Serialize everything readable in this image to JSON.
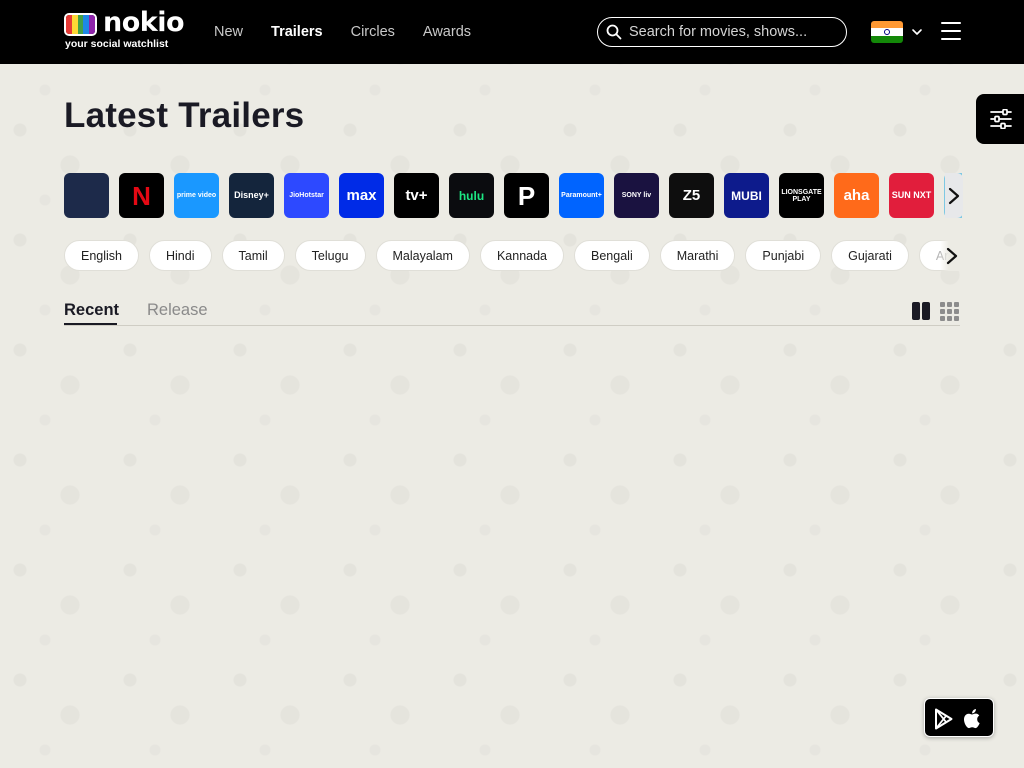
{
  "header": {
    "logo_word": "nokio",
    "logo_tagline": "your social watchlist",
    "nav": [
      {
        "label": "New",
        "active": false
      },
      {
        "label": "Trailers",
        "active": true
      },
      {
        "label": "Circles",
        "active": false
      },
      {
        "label": "Awards",
        "active": false
      }
    ],
    "search": {
      "placeholder": "Search for movies, shows...",
      "icon": "search-icon"
    },
    "region_flag": "flag-india-icon",
    "menu_icon": "hamburger-menu-icon"
  },
  "main": {
    "title": "Latest Trailers",
    "filter_icon": "sliders-icon"
  },
  "providers": [
    {
      "name": "all-providers",
      "label": "",
      "bg": "#1d2a4a",
      "fg": "#fff"
    },
    {
      "name": "netflix",
      "label": "N",
      "bg": "#000000",
      "fg": "#e50914"
    },
    {
      "name": "prime-video",
      "label": "prime video",
      "bg": "#1a98ff",
      "fg": "#ffffff"
    },
    {
      "name": "disney-plus",
      "label": "Disney+",
      "bg": "#14253c",
      "fg": "#ffffff"
    },
    {
      "name": "jiohotstar",
      "label": "JioHotstar",
      "bg": "#2d49ff",
      "fg": "#ffffff"
    },
    {
      "name": "max",
      "label": "max",
      "bg": "#002be7",
      "fg": "#ffffff"
    },
    {
      "name": "apple-tv-plus",
      "label": "tv+",
      "bg": "#000000",
      "fg": "#ffffff"
    },
    {
      "name": "hulu",
      "label": "hulu",
      "bg": "#0b0c0f",
      "fg": "#1ce783"
    },
    {
      "name": "peacock",
      "label": "P",
      "bg": "#000000",
      "fg": "#ffffff"
    },
    {
      "name": "paramount-plus",
      "label": "Paramount+",
      "bg": "#0064ff",
      "fg": "#ffffff"
    },
    {
      "name": "sony-liv",
      "label": "SONY liv",
      "bg": "#1a1240",
      "fg": "#ffffff"
    },
    {
      "name": "zee5",
      "label": "Z5",
      "bg": "#0e0e0e",
      "fg": "#ffffff"
    },
    {
      "name": "mubi",
      "label": "MUBI",
      "bg": "#0d1b8c",
      "fg": "#ffffff"
    },
    {
      "name": "lionsgate-play",
      "label": "LIONSGATE PLAY",
      "bg": "#000000",
      "fg": "#ffffff"
    },
    {
      "name": "aha",
      "label": "aha",
      "bg": "#ff6a1a",
      "fg": "#ffffff"
    },
    {
      "name": "sun-nxt",
      "label": "SUN NXT",
      "bg": "#e11e3c",
      "fg": "#ffffff"
    },
    {
      "name": "next-provider",
      "label": "",
      "bg": "#7ec8e3",
      "fg": "#ffffff"
    }
  ],
  "languages": [
    "English",
    "Hindi",
    "Tamil",
    "Telugu",
    "Malayalam",
    "Kannada",
    "Bengali",
    "Marathi",
    "Punjabi",
    "Gujarati",
    "Ara"
  ],
  "tabs": [
    {
      "label": "Recent",
      "active": true
    },
    {
      "label": "Release",
      "active": false
    }
  ],
  "view_modes": [
    "two-column-view-icon",
    "grid-view-icon"
  ],
  "app_badges": [
    "google-play-icon",
    "apple-icon"
  ],
  "colors": {
    "header_bg": "#000000",
    "page_bg": "#ecebe4",
    "accent_text": "#1a1a24"
  }
}
